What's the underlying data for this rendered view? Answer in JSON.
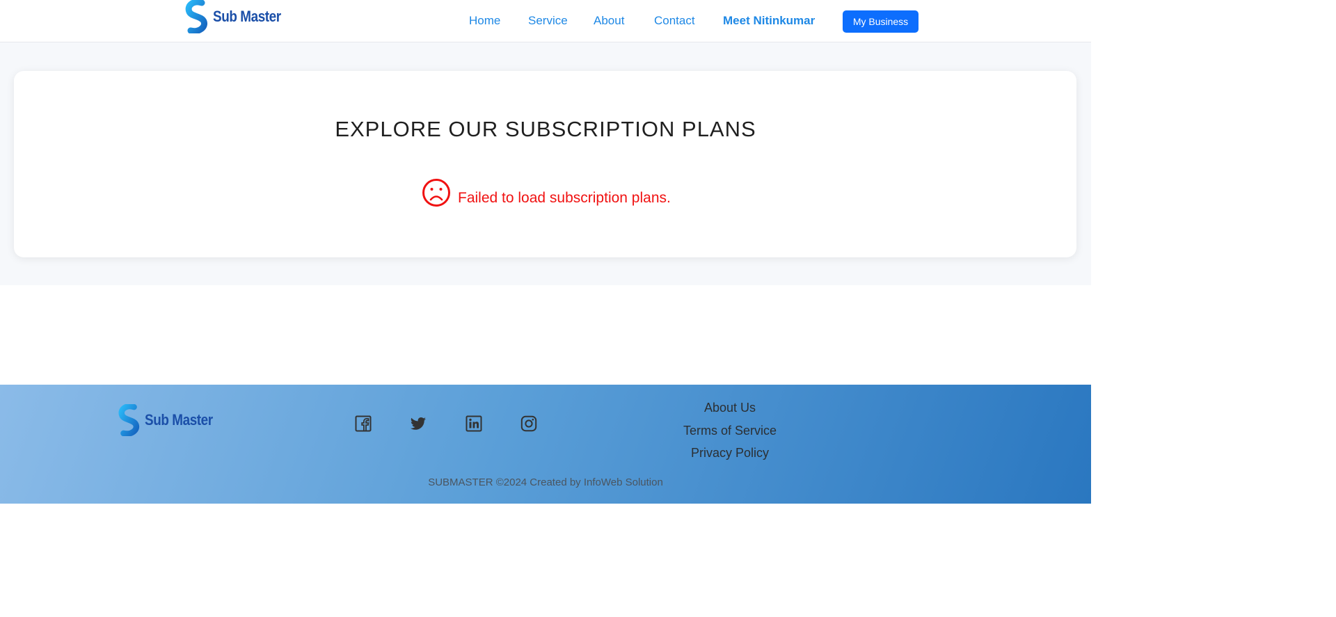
{
  "brand": {
    "name": "Sub Master",
    "colors": {
      "primary": "#1b4fa8",
      "accent": "#1e88e5",
      "button": "#0d6efd"
    }
  },
  "nav": {
    "items": [
      "Home",
      "Service",
      "About",
      "Contact"
    ],
    "highlight": "Meet Nitinkumar",
    "cta": "My Business"
  },
  "main": {
    "title": "EXPLORE OUR SUBSCRIPTION PLANS",
    "error_icon": "sad-face-icon",
    "error_message": "Failed to load subscription plans.",
    "error_color": "#f01111"
  },
  "footer": {
    "brand_name": "Sub Master",
    "social": [
      "facebook-icon",
      "twitter-icon",
      "linkedin-icon",
      "instagram-icon"
    ],
    "links": [
      "About Us",
      "Terms of Service",
      "Privacy Policy"
    ],
    "copyright": "SUBMASTER ©2024 Created by InfoWeb Solution"
  }
}
